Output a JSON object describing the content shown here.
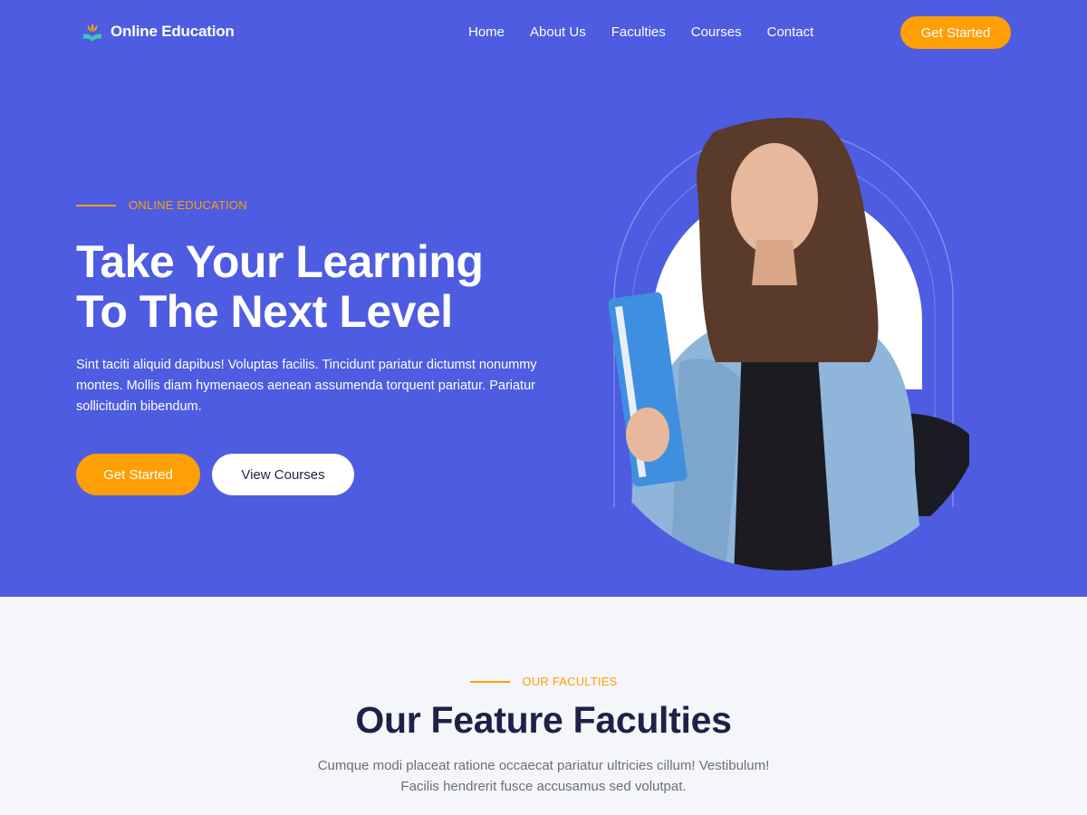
{
  "brand": {
    "name": "Online Education",
    "icon": "book-leaf-logo-icon"
  },
  "nav": {
    "links": [
      "Home",
      "About Us",
      "Faculties",
      "Courses",
      "Contact"
    ],
    "cta": "Get Started"
  },
  "hero": {
    "eyebrow": "ONLINE EDUCATION",
    "title_line1": "Take Your Learning",
    "title_line2": "To The Next Level",
    "description": "Sint taciti aliquid dapibus! Voluptas facilis. Tincidunt pariatur dictumst nonummy montes. Mollis diam hymenaeos aenean assumenda torquent pariatur. Pariatur sollicitudin bibendum.",
    "primary_button": "Get Started",
    "secondary_button": "View Courses",
    "image": "student-holding-notebooks-illustration"
  },
  "faculties": {
    "eyebrow": "OUR FACULTIES",
    "title": "Our Feature Faculties",
    "description": "Cumque modi placeat ratione occaecat pariatur ultricies cillum! Vestibulum! Facilis hendrerit fusce accusamus sed volutpat."
  },
  "colors": {
    "hero_bg": "#4d5ce1",
    "accent": "#ff9f06",
    "dark_text": "#1e2147",
    "section_bg": "#f5f6fa"
  }
}
